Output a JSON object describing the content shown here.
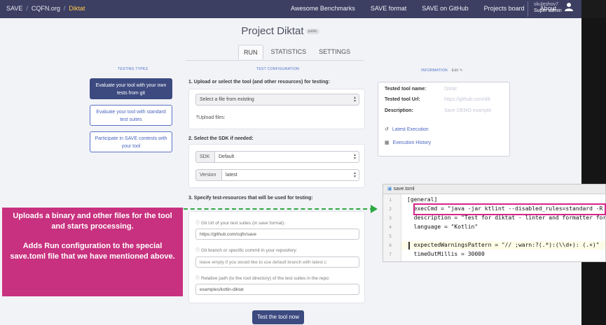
{
  "navbar": {
    "crumbs": [
      "SAVE",
      "CQFN.org",
      "Diktat"
    ],
    "links": [
      "Awesome Benchmarks",
      "SAVE format",
      "SAVE on GitHub",
      "Projects board",
      "About"
    ],
    "user": {
      "name": "skuleshov7",
      "role": "Super admin"
    }
  },
  "project": {
    "title": "Project Diktat",
    "badge": "public"
  },
  "tabs": [
    "RUN",
    "STATISTICS",
    "SETTINGS"
  ],
  "testing_types": {
    "heading": "TESTING TYPES",
    "options": [
      "Evaluate your tool with your own tests from git",
      "Evaluate your tool with standard test suites",
      "Participate in SAVE contests with your tool"
    ]
  },
  "config": {
    "heading": "TEST CONFIGURATION",
    "step1": "1. Upload or select the tool (and other resources) for testing:",
    "file_select": "Select a file from existing",
    "upload": "Upload files:",
    "step2": "2. Select the SDK if needed:",
    "sdk_label": "SDK",
    "sdk_value": "Default",
    "version_label": "Version",
    "version_value": "latest",
    "step3": "3. Specify test-resources that will be used for testing:",
    "git_url_label": "Git Url of your test suites (in save format):",
    "git_url_value": "https://github.com/cqfn/save",
    "branch_label": "Git branch or specific commit in your repository:",
    "branch_placeholder": "leave empty if you would like to use default branch with latest c",
    "path_label": "Relative path (to the root directory) of the test suites in the repo:",
    "path_value": "examples/kotlin-diktat",
    "run_button": "Test the tool now"
  },
  "information": {
    "heading": "INFORMATION",
    "edit": "Edit",
    "rows": [
      {
        "key": "Tested tool name:",
        "value": "Diktat"
      },
      {
        "key": "Tested tool Url:",
        "value": "https://github.com/dik"
      },
      {
        "key": "Description:",
        "value": "Save DEMO example"
      }
    ],
    "links": [
      "Latest Execution",
      "Execution History"
    ]
  },
  "callout": {
    "p1": "Uploads a binary and other files for the tool and starts processing.",
    "p2": "Adds Run configuration to the special save.toml file that we have mentioned above."
  },
  "editor": {
    "filename": "save.toml",
    "line_numbers": [
      "1",
      "2",
      "3",
      "4",
      "5",
      "6",
      "7"
    ],
    "lines": [
      "[general]",
      "  execCmd = \"java -jar ktlint --disabled_rules=standard -R",
      "  description = \"Test for diktat - linter and formatter for",
      "  language = \"Kotlin\"",
      "",
      "  expectedWarningsPattern = \"// ;warn:?(.*):(\\\\d+): (.+)\"",
      "  timeOutMillis = 30000"
    ]
  },
  "colors": {
    "navbar": "#3c3f62",
    "accent": "#3c4a80",
    "callout": "#c8317f",
    "arrow": "#2ea843"
  }
}
